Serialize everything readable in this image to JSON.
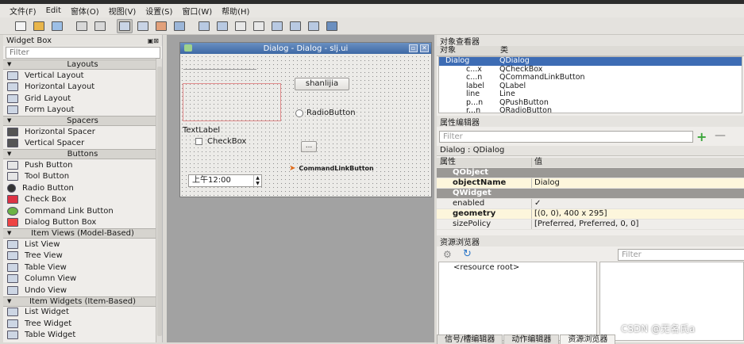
{
  "menubar": [
    "文件(F)",
    "Edit",
    "窗体(O)",
    "视图(V)",
    "设置(S)",
    "窗口(W)",
    "帮助(H)"
  ],
  "widget_box": {
    "title": "Widget Box",
    "filter_placeholder": "Filter",
    "sections": [
      {
        "label": "Layouts",
        "items": [
          "Vertical Layout",
          "Horizontal Layout",
          "Grid Layout",
          "Form Layout"
        ]
      },
      {
        "label": "Spacers",
        "items": [
          "Horizontal Spacer",
          "Vertical Spacer"
        ]
      },
      {
        "label": "Buttons",
        "items": [
          "Push Button",
          "Tool Button",
          "Radio Button",
          "Check Box",
          "Command Link Button",
          "Dialog Button Box"
        ]
      },
      {
        "label": "Item Views (Model-Based)",
        "items": [
          "List View",
          "Tree View",
          "Table View",
          "Column View",
          "Undo View"
        ]
      },
      {
        "label": "Item Widgets (Item-Based)",
        "items": [
          "List Widget",
          "Tree Widget",
          "Table Widget"
        ]
      }
    ]
  },
  "dialog": {
    "title": "Dialog - Dialog - slj.ui",
    "push_button": "shanlijia",
    "radio_button": "RadioButton",
    "text_label": "TextLabel",
    "check_box": "CheckBox",
    "tool_button": "...",
    "command_link": "CommandLinkButton",
    "time_edit": "上午12:00"
  },
  "object_inspector": {
    "title": "对象查看器",
    "col_object": "对象",
    "col_class": "类",
    "rows": [
      {
        "object": "Dialog",
        "class": "QDialog"
      },
      {
        "object": "c...x",
        "class": "QCheckBox"
      },
      {
        "object": "c...n",
        "class": "QCommandLinkButton"
      },
      {
        "object": "label",
        "class": "QLabel"
      },
      {
        "object": "line",
        "class": "Line"
      },
      {
        "object": "p...n",
        "class": "QPushButton"
      },
      {
        "object": "r...n",
        "class": "QRadioButton"
      }
    ]
  },
  "property_editor": {
    "title": "属性编辑器",
    "filter_placeholder": "Filter",
    "object_line": "Dialog : QDialog",
    "col_property": "属性",
    "col_value": "值",
    "rows": [
      {
        "k": "QObject",
        "v": ""
      },
      {
        "k": "objectName",
        "v": "Dialog"
      },
      {
        "k": "QWidget",
        "v": ""
      },
      {
        "k": "enabled",
        "v": "✓"
      },
      {
        "k": "geometry",
        "v": "[(0, 0), 400 x 295]"
      },
      {
        "k": "sizePolicy",
        "v": "[Preferred, Preferred, 0, 0]"
      }
    ]
  },
  "resource_browser": {
    "title": "资源浏览器",
    "filter_placeholder": "Filter",
    "root": "<resource root>"
  },
  "tabs": [
    "信号/槽编辑器",
    "动作编辑器",
    "资源浏览器"
  ],
  "watermark": "CSDN @无名氏a"
}
